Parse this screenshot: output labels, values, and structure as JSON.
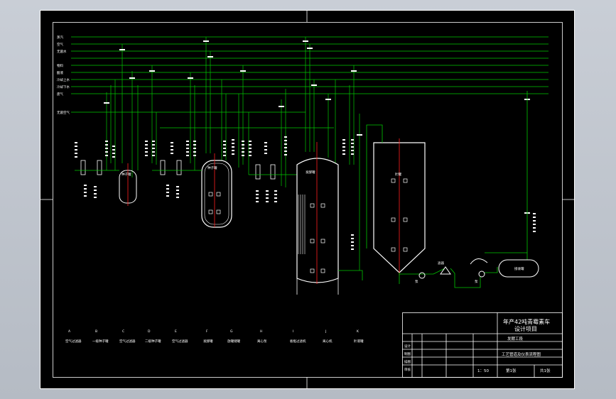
{
  "colors": {
    "background": "#000000",
    "frame": "#ffffff",
    "pipes": "#00c800",
    "centerline": "#ff2020",
    "app_bg": "#c0c6cf"
  },
  "pipe_labels": [
    "蒸汽",
    "空气",
    "无菌水",
    "",
    "物料",
    "酸液",
    "冷却上水",
    "冷却下水",
    "废气"
  ],
  "side_label": "无菌空气",
  "equipment": {
    "seed_tank_1": "种子罐",
    "seed_tank_2": "种子罐",
    "seed_tank_3": "种子罐",
    "fermenter": "发酵罐",
    "storage_tank": "贮罐",
    "pump_1": "泵",
    "pump_2": "泵",
    "filter": "滤器",
    "receiver": "接收罐"
  },
  "legend": [
    {
      "code": "A",
      "name": "空气过滤器"
    },
    {
      "code": "B",
      "name": "一级种子罐"
    },
    {
      "code": "C",
      "name": "空气过滤器"
    },
    {
      "code": "D",
      "name": "二级种子罐"
    },
    {
      "code": "E",
      "name": "空气过滤器"
    },
    {
      "code": "F",
      "name": "发酵罐"
    },
    {
      "code": "G",
      "name": "放罐储罐"
    },
    {
      "code": "H",
      "name": "离心泵"
    },
    {
      "code": "I",
      "name": "板框过滤机"
    },
    {
      "code": "J",
      "name": "离心机"
    },
    {
      "code": "K",
      "name": "贮液罐"
    }
  ],
  "title_block": {
    "project_line1": "年产42吨青霉素车",
    "project_line2": "设计项目",
    "dept": "发酵工段",
    "drawing_name": "工艺管道及仪表流程图",
    "scale": "1：50",
    "sheet": "第1张",
    "total": "共1张",
    "row_labels": [
      "设计",
      "制图",
      "描图",
      "审核"
    ]
  }
}
